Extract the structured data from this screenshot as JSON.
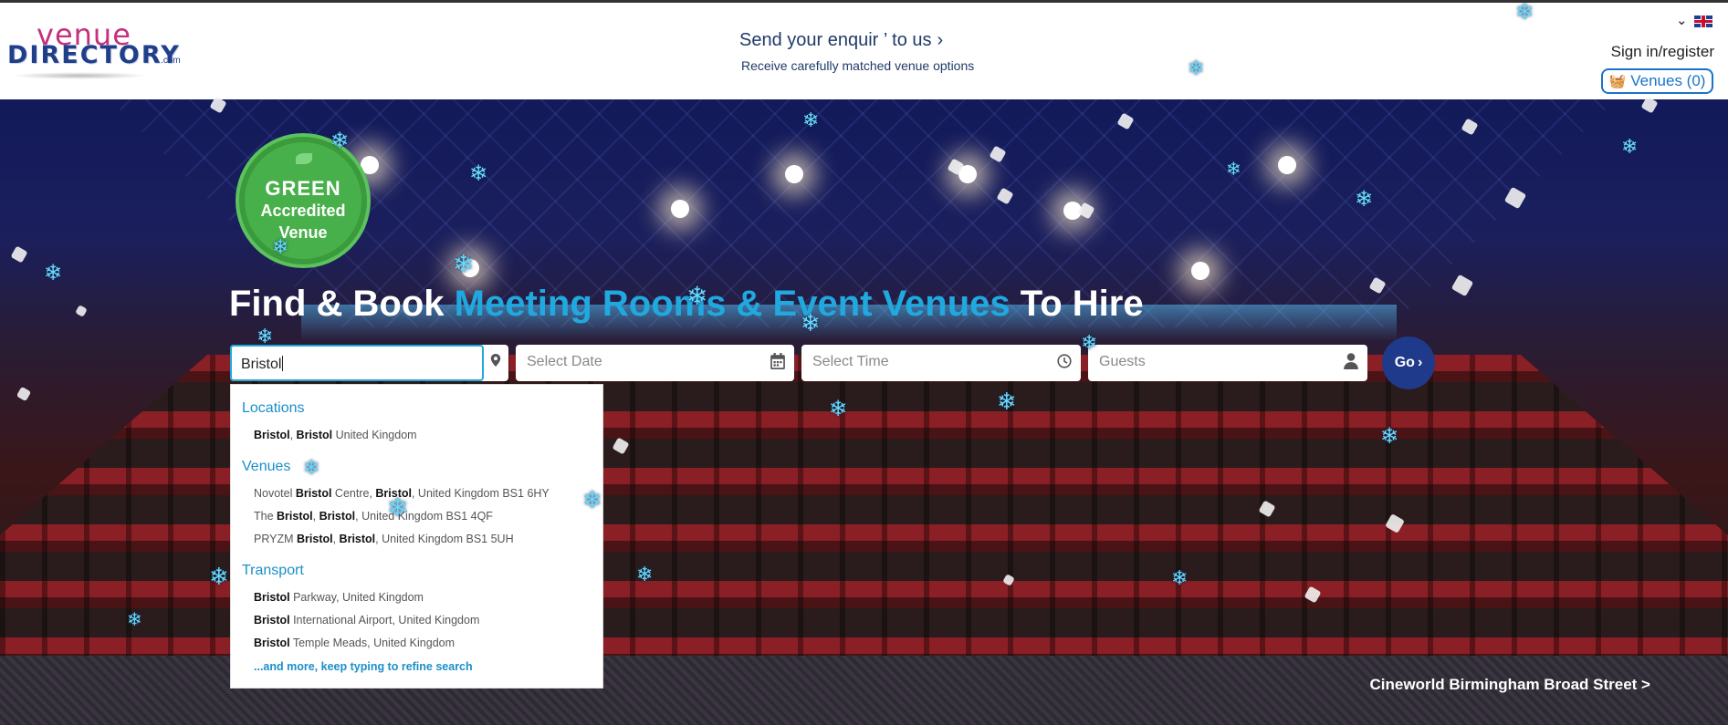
{
  "header": {
    "logo_top": "venue",
    "logo_main": "DIRECTORY",
    "logo_suffix": ".com",
    "enquiry_title": "Send your enquir ’ to us",
    "enquiry_subtitle": "Receive carefully matched venue options",
    "sign_in": "Sign in/register",
    "venues_button": "Venues (0)"
  },
  "badge": {
    "line1": "GREEN",
    "line2": "Accredited",
    "line3": "Venue"
  },
  "hero": {
    "headline_start": "Find & Book ",
    "headline_accent": "Meeting Rooms & Event Venues",
    "headline_end": " To Hire",
    "caption": "Cineworld Birmingham Broad Street >"
  },
  "search": {
    "location_value": "Bristol",
    "date_placeholder": "Select Date",
    "time_placeholder": "Select Time",
    "guests_placeholder": "Guests",
    "go_label": "Go"
  },
  "dropdown": {
    "locations_heading": "Locations",
    "venues_heading": "Venues",
    "transport_heading": "Transport",
    "more": "...and more, keep typing to refine search"
  },
  "icons": {
    "snowflake": "snowflake-icon",
    "pin": "map-pin-icon",
    "calendar": "calendar-icon",
    "clock": "clock-icon",
    "user": "user-icon",
    "basket": "basket-icon",
    "flag": "uk-flag-icon"
  },
  "colors": {
    "accent": "#20a9df",
    "brand": "#1f3a8a",
    "badge_green": "#48b04a"
  }
}
